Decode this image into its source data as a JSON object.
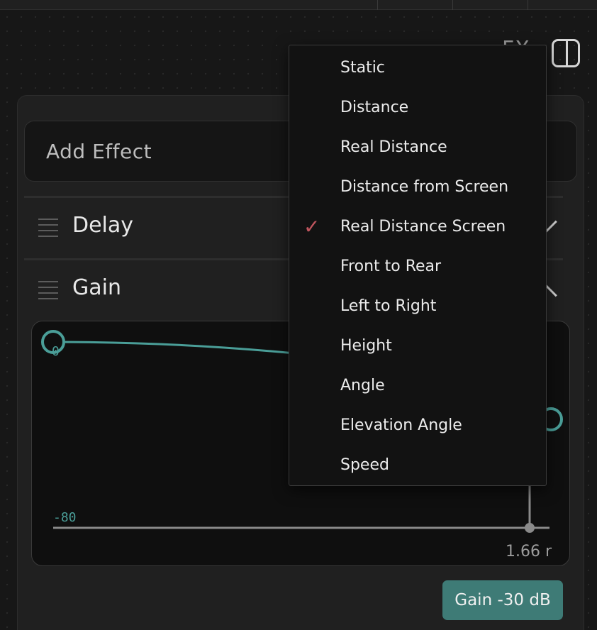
{
  "header": {
    "fx_label": "FX"
  },
  "add_effect": {
    "label": "Add Effect"
  },
  "effects": [
    {
      "name": "Delay"
    },
    {
      "name": "Gain"
    }
  ],
  "graph": {
    "y_top_label": "0",
    "y_bottom_label": "-80",
    "x_value_label": "1.66 r",
    "accent_color": "#4a9e98"
  },
  "gain_button": {
    "label": "Gain -30 dB",
    "color": "#3e7b76"
  },
  "dropdown": {
    "selected_index": 4,
    "check_color": "#c0555e",
    "check_glyph": "✓",
    "items": [
      "Static",
      "Distance",
      "Real Distance",
      "Distance from Screen",
      "Real Distance Screen",
      "Front to Rear",
      "Left to Right",
      "Height",
      "Angle",
      "Elevation Angle",
      "Speed"
    ]
  }
}
